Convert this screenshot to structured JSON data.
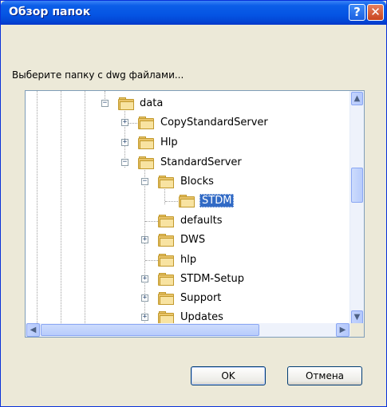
{
  "window": {
    "title": "Обзор папок",
    "help_label": "?",
    "close_label": "✕"
  },
  "prompt": "Выберите папку с dwg файлами...",
  "tree": {
    "nodes": [
      {
        "label": "data",
        "expander": "−"
      },
      {
        "label": "CopyStandardServer",
        "expander": "+"
      },
      {
        "label": "Hlp",
        "expander": "+"
      },
      {
        "label": "StandardServer",
        "expander": "−"
      },
      {
        "label": "Blocks",
        "expander": "−"
      },
      {
        "label": "STDM",
        "selected": true
      },
      {
        "label": "defaults"
      },
      {
        "label": "DWS",
        "expander": "+"
      },
      {
        "label": "hlp"
      },
      {
        "label": "STDM-Setup",
        "expander": "+"
      },
      {
        "label": "Support",
        "expander": "+"
      },
      {
        "label": "Updates",
        "expander": "+"
      }
    ]
  },
  "scrollbar": {
    "up": "▲",
    "down": "▼",
    "left": "◀",
    "right": "▶"
  },
  "buttons": {
    "ok": "OK",
    "cancel": "Отмена"
  }
}
